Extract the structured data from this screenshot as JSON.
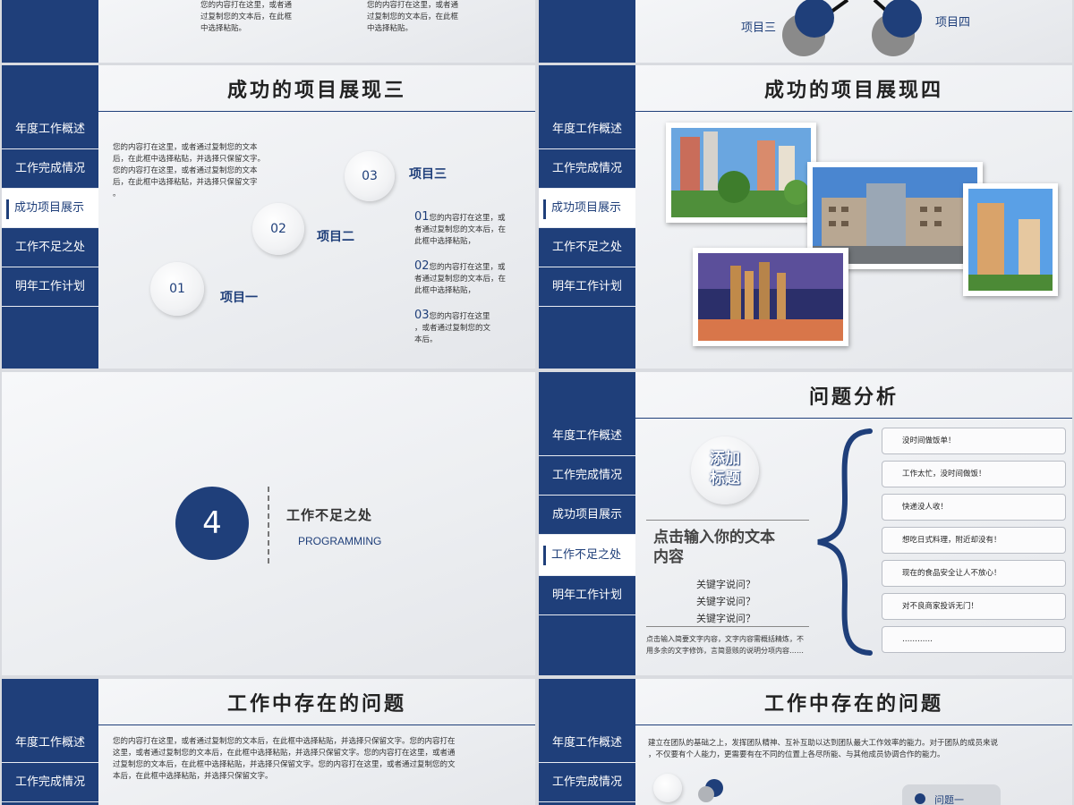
{
  "nav_items": [
    "年度工作概述",
    "工作完成情况",
    "成功项目展示",
    "工作不足之处",
    "明年工作计划"
  ],
  "slide_top_left": {
    "text_a": [
      "您的内容打在这里，或者通",
      "过复制您的文本后，在此框",
      "中选择粘贴。"
    ],
    "text_b": [
      "您的内容打在这里，或者通",
      "过复制您的文本后，在此框",
      "中选择粘贴。"
    ]
  },
  "slide_top_right": {
    "label_three": "项目三",
    "label_four": "项目四"
  },
  "slide_projects_three": {
    "title": "成功的项目展现三",
    "intro": [
      "您的内容打在这里，或者通过复制您的文本",
      "后，在此框中选择粘贴，并选择只保留文字。",
      "您的内容打在这里，或者通过复制您的文本",
      "后，在此框中选择粘贴，并选择只保留文字",
      "。"
    ],
    "circles": [
      {
        "num": "03",
        "label": "项目三"
      },
      {
        "num": "02",
        "label": "项目二"
      },
      {
        "num": "01",
        "label": "项目一"
      }
    ],
    "items": [
      {
        "num": "01",
        "lines": [
          "您的内容打在这里，或",
          "者通过复制您的文本后，在",
          "此框中选择粘贴，"
        ]
      },
      {
        "num": "02",
        "lines": [
          "您的内容打在这里，或",
          "者通过复制您的文本后，在",
          "此框中选择粘贴，"
        ]
      },
      {
        "num": "03",
        "lines": [
          "您的内容打在这里",
          "，或者通过复制您的文",
          "本后。"
        ]
      }
    ]
  },
  "slide_projects_four": {
    "title": "成功的项目展现四"
  },
  "slide_section": {
    "number": "4",
    "title": "工作不足之处",
    "subtitle": "PROGRAMMING"
  },
  "slide_analysis": {
    "title": "问题分析",
    "badge": [
      "添加",
      "标题"
    ],
    "main_text": [
      "点击输入你的文本",
      "内容"
    ],
    "keywords": [
      "关键字说问？",
      "关键字说问？",
      "关键字说问？"
    ],
    "note": [
      "点击输入简要文字内容，文字内容需概括精炼，不",
      "用多余的文字修饰，言简意赅的说明分项内容……"
    ],
    "pills": [
      "没时间做饭单！",
      "工作太忙，没时间做饭！",
      "快递没人收！",
      "想吃日式料理，附近却没有！",
      "现在的食品安全让人不放心！",
      "对不良商家投诉无门！",
      "…………"
    ]
  },
  "slide_problems_left": {
    "title": "工作中存在的问题",
    "body": [
      "您的内容打在这里，或者通过复制您的文本后，在此框中选择粘贴，并选择只保留文字。您的内容打在",
      "这里，或者通过复制您的文本后，在此框中选择粘贴，并选择只保留文字。您的内容打在这里，或者通",
      "过复制您的文本后，在此框中选择粘贴，并选择只保留文字。您的内容打在这里，或者通过复制您的文",
      "本后，在此框中选择粘贴，并选择只保留文字。"
    ]
  },
  "slide_problems_right": {
    "title": "工作中存在的问题",
    "body": [
      "建立在团队的基础之上，发挥团队精神、互补互助以达到团队最大工作效率的能力。对于团队的成员来说",
      "，不仅要有个人能力，更需要有在不同的位置上各尽所能、与其他成员协调合作的能力。"
    ],
    "tag": "问题一"
  },
  "colors": {
    "accent": "#1f3f7a",
    "background": "#eceef1"
  }
}
